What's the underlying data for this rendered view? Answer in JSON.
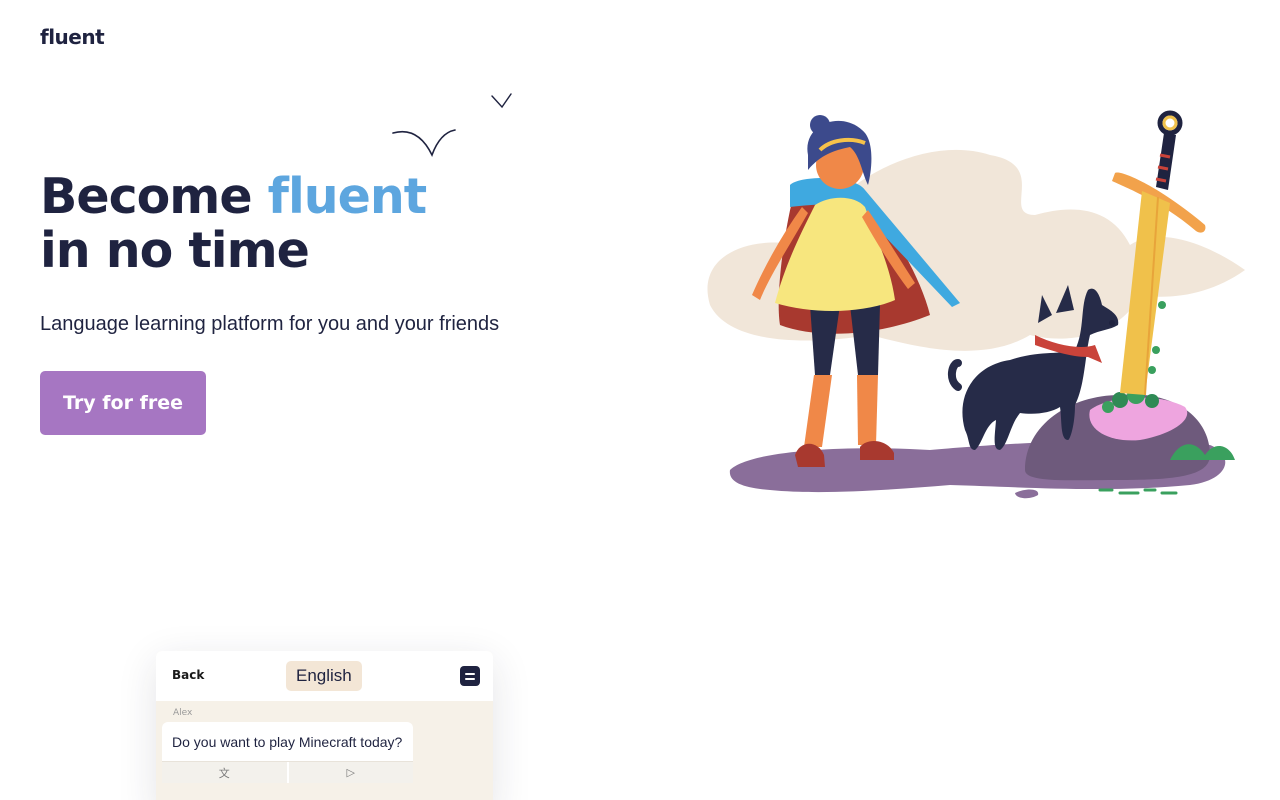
{
  "brand": {
    "logo": "fluent"
  },
  "hero": {
    "title_part1": "Become ",
    "title_accent": "fluent",
    "title_line2": "in no time",
    "subtitle": "Language learning platform for you and your friends",
    "cta_label": "Try for free"
  },
  "colors": {
    "accent_blue": "#5da6df",
    "cta_purple": "#a676c2",
    "ink": "#1f2340",
    "chat_bg": "#f6f1e8",
    "pill_bg": "#f3e6d6"
  },
  "chat_preview": {
    "back_label": "Back",
    "language": "English",
    "menu_icon": "menu-icon",
    "sender": "Alex",
    "message": "Do you want to play Minecraft today?",
    "translate_icon": "文",
    "play_icon": "▷"
  }
}
